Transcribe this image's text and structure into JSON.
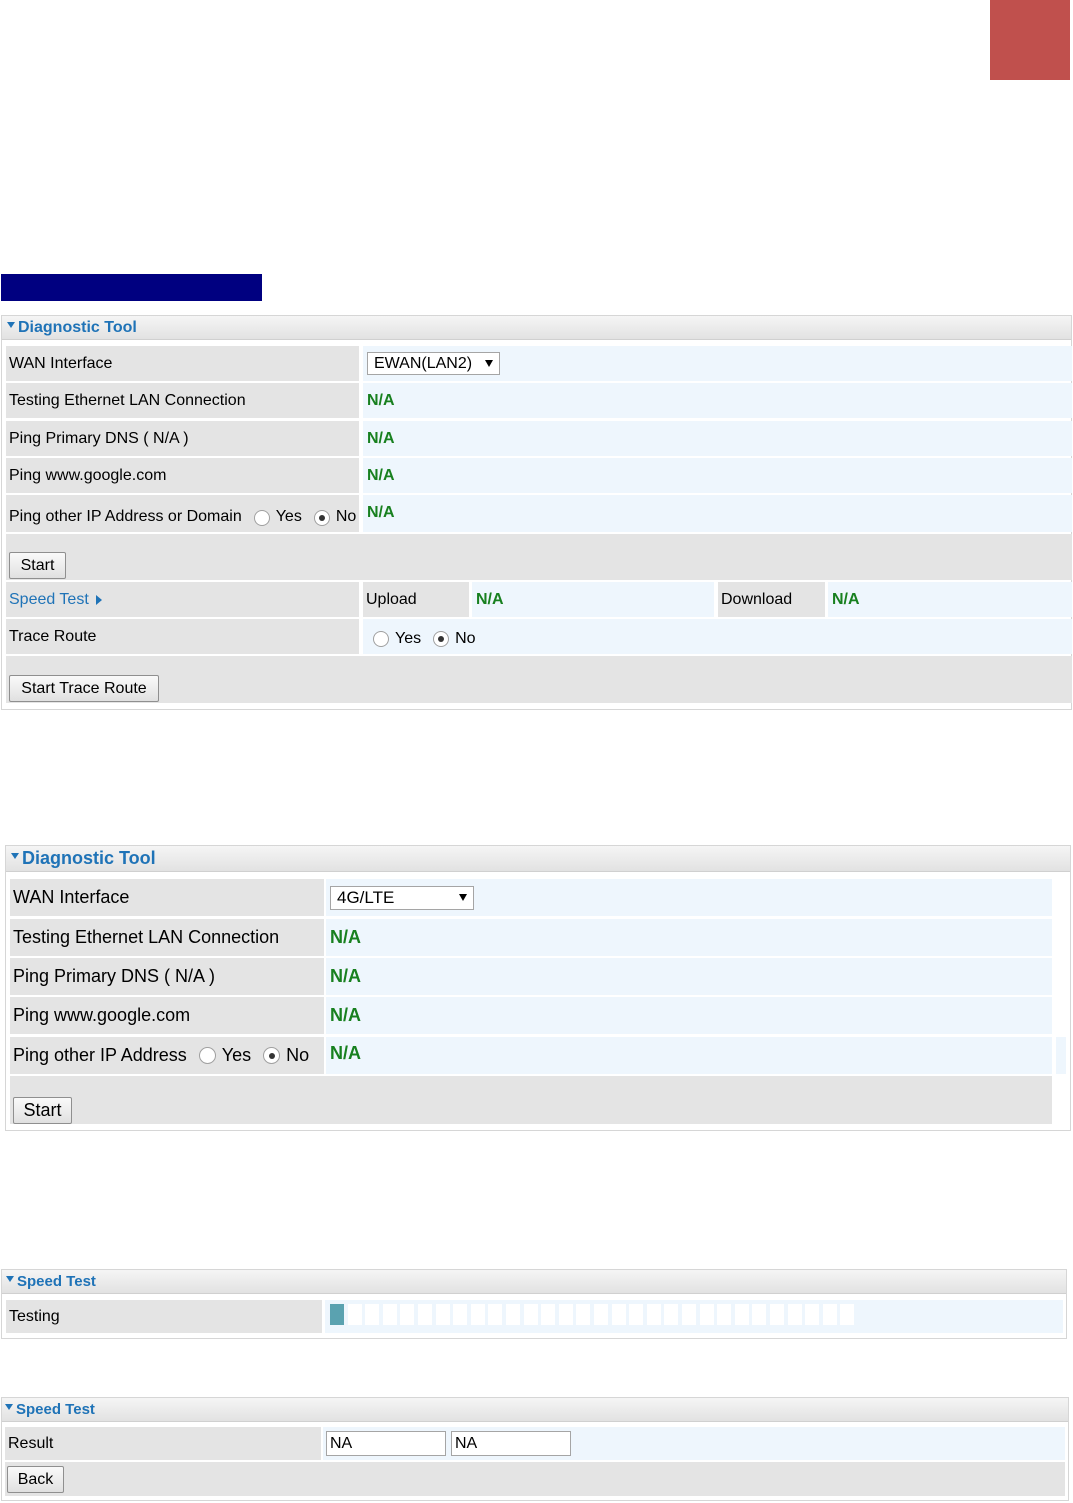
{
  "colors": {
    "corner_block": "#c0504d",
    "banner": "#000080",
    "accent": "#1f73b7",
    "status_green": "#18801f",
    "progress_fill": "#5aa2b0"
  },
  "panel1": {
    "title": "Diagnostic Tool",
    "wan_label": "WAN Interface",
    "wan_value": "EWAN(LAN2)",
    "eth_label": "Testing Ethernet LAN Connection",
    "eth_value": "N/A",
    "dns_label": "Ping Primary DNS ( N/A )",
    "dns_value": "N/A",
    "google_label": "Ping www.google.com",
    "google_value": "N/A",
    "other_label": "Ping other IP Address or Domain",
    "other_yes": "Yes",
    "other_no": "No",
    "other_value": "N/A",
    "start_button": "Start",
    "speed_label": "Speed Test",
    "upload_label": "Upload",
    "upload_value": "N/A",
    "download_label": "Download",
    "download_value": "N/A",
    "trace_label": "Trace Route",
    "trace_yes": "Yes",
    "trace_no": "No",
    "trace_button": "Start Trace Route"
  },
  "panel2": {
    "title": "Diagnostic Tool",
    "wan_label": "WAN Interface",
    "wan_value": "4G/LTE",
    "eth_label": "Testing Ethernet LAN Connection",
    "eth_value": "N/A",
    "dns_label": "Ping Primary DNS ( N/A )",
    "dns_value": "N/A",
    "google_label": "Ping www.google.com",
    "google_value": "N/A",
    "other_label": "Ping other IP Address",
    "other_yes": "Yes",
    "other_no": "No",
    "other_value": "N/A",
    "start_button": "Start"
  },
  "panel3": {
    "title": "Speed Test",
    "testing_label": "Testing",
    "progress": {
      "segments": 30,
      "filled": 1
    }
  },
  "panel4": {
    "title": "Speed Test",
    "result_label": "Result",
    "result_upload": "NA",
    "result_download": "NA",
    "back_button": "Back"
  }
}
